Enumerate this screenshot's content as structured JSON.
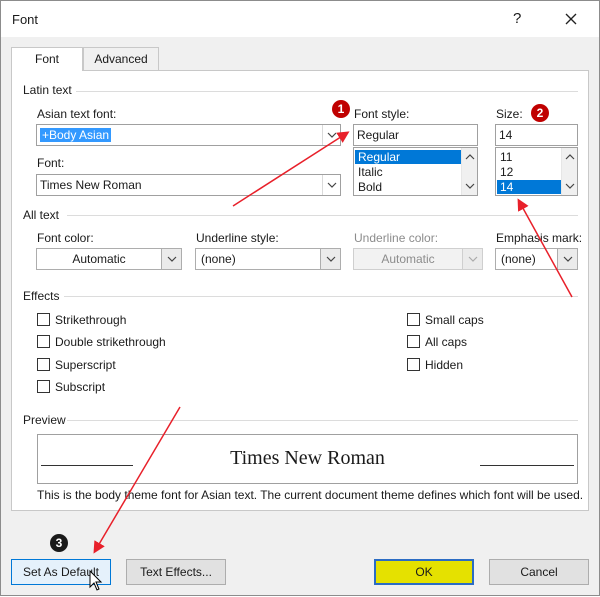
{
  "dialog": {
    "title": "Font",
    "help": "?",
    "close_icon": "close-icon"
  },
  "tabs": [
    {
      "label": "Font",
      "active": true
    },
    {
      "label": "Advanced",
      "active": false
    }
  ],
  "latin_text": {
    "group_label": "Latin text",
    "asian_font_label": "Asian text font:",
    "asian_font_value": "+Body Asian",
    "font_label": "Font:",
    "font_value": "Times New Roman",
    "style_label": "Font style:",
    "style_value": "Regular",
    "style_options": [
      "Regular",
      "Italic",
      "Bold"
    ],
    "style_selected": "Regular",
    "size_label": "Size:",
    "size_value": "14",
    "size_options": [
      "11",
      "12",
      "14"
    ],
    "size_selected": "14"
  },
  "all_text": {
    "group_label": "All text",
    "font_color_label": "Font color:",
    "font_color_value": "Automatic",
    "underline_style_label": "Underline style:",
    "underline_style_value": "(none)",
    "underline_color_label": "Underline color:",
    "underline_color_value": "Automatic",
    "emphasis_label": "Emphasis mark:",
    "emphasis_value": "(none)"
  },
  "effects": {
    "group_label": "Effects",
    "left": [
      "Strikethrough",
      "Double strikethrough",
      "Superscript",
      "Subscript"
    ],
    "right": [
      "Small caps",
      "All caps",
      "Hidden"
    ]
  },
  "preview": {
    "group_label": "Preview",
    "sample": "Times New Roman",
    "description": "This is the body theme font for Asian text. The current document theme defines which font will be used."
  },
  "buttons": {
    "set_default": "Set As Default",
    "text_effects": "Text Effects...",
    "ok": "OK",
    "cancel": "Cancel"
  },
  "annotations": {
    "badge_1": "1",
    "badge_2": "2",
    "badge_3": "3",
    "arrow_color": "#e8202a"
  },
  "colors": {
    "ok_button": "#e5e100",
    "selection": "#0078d7",
    "annotation_red": "#c00000"
  }
}
